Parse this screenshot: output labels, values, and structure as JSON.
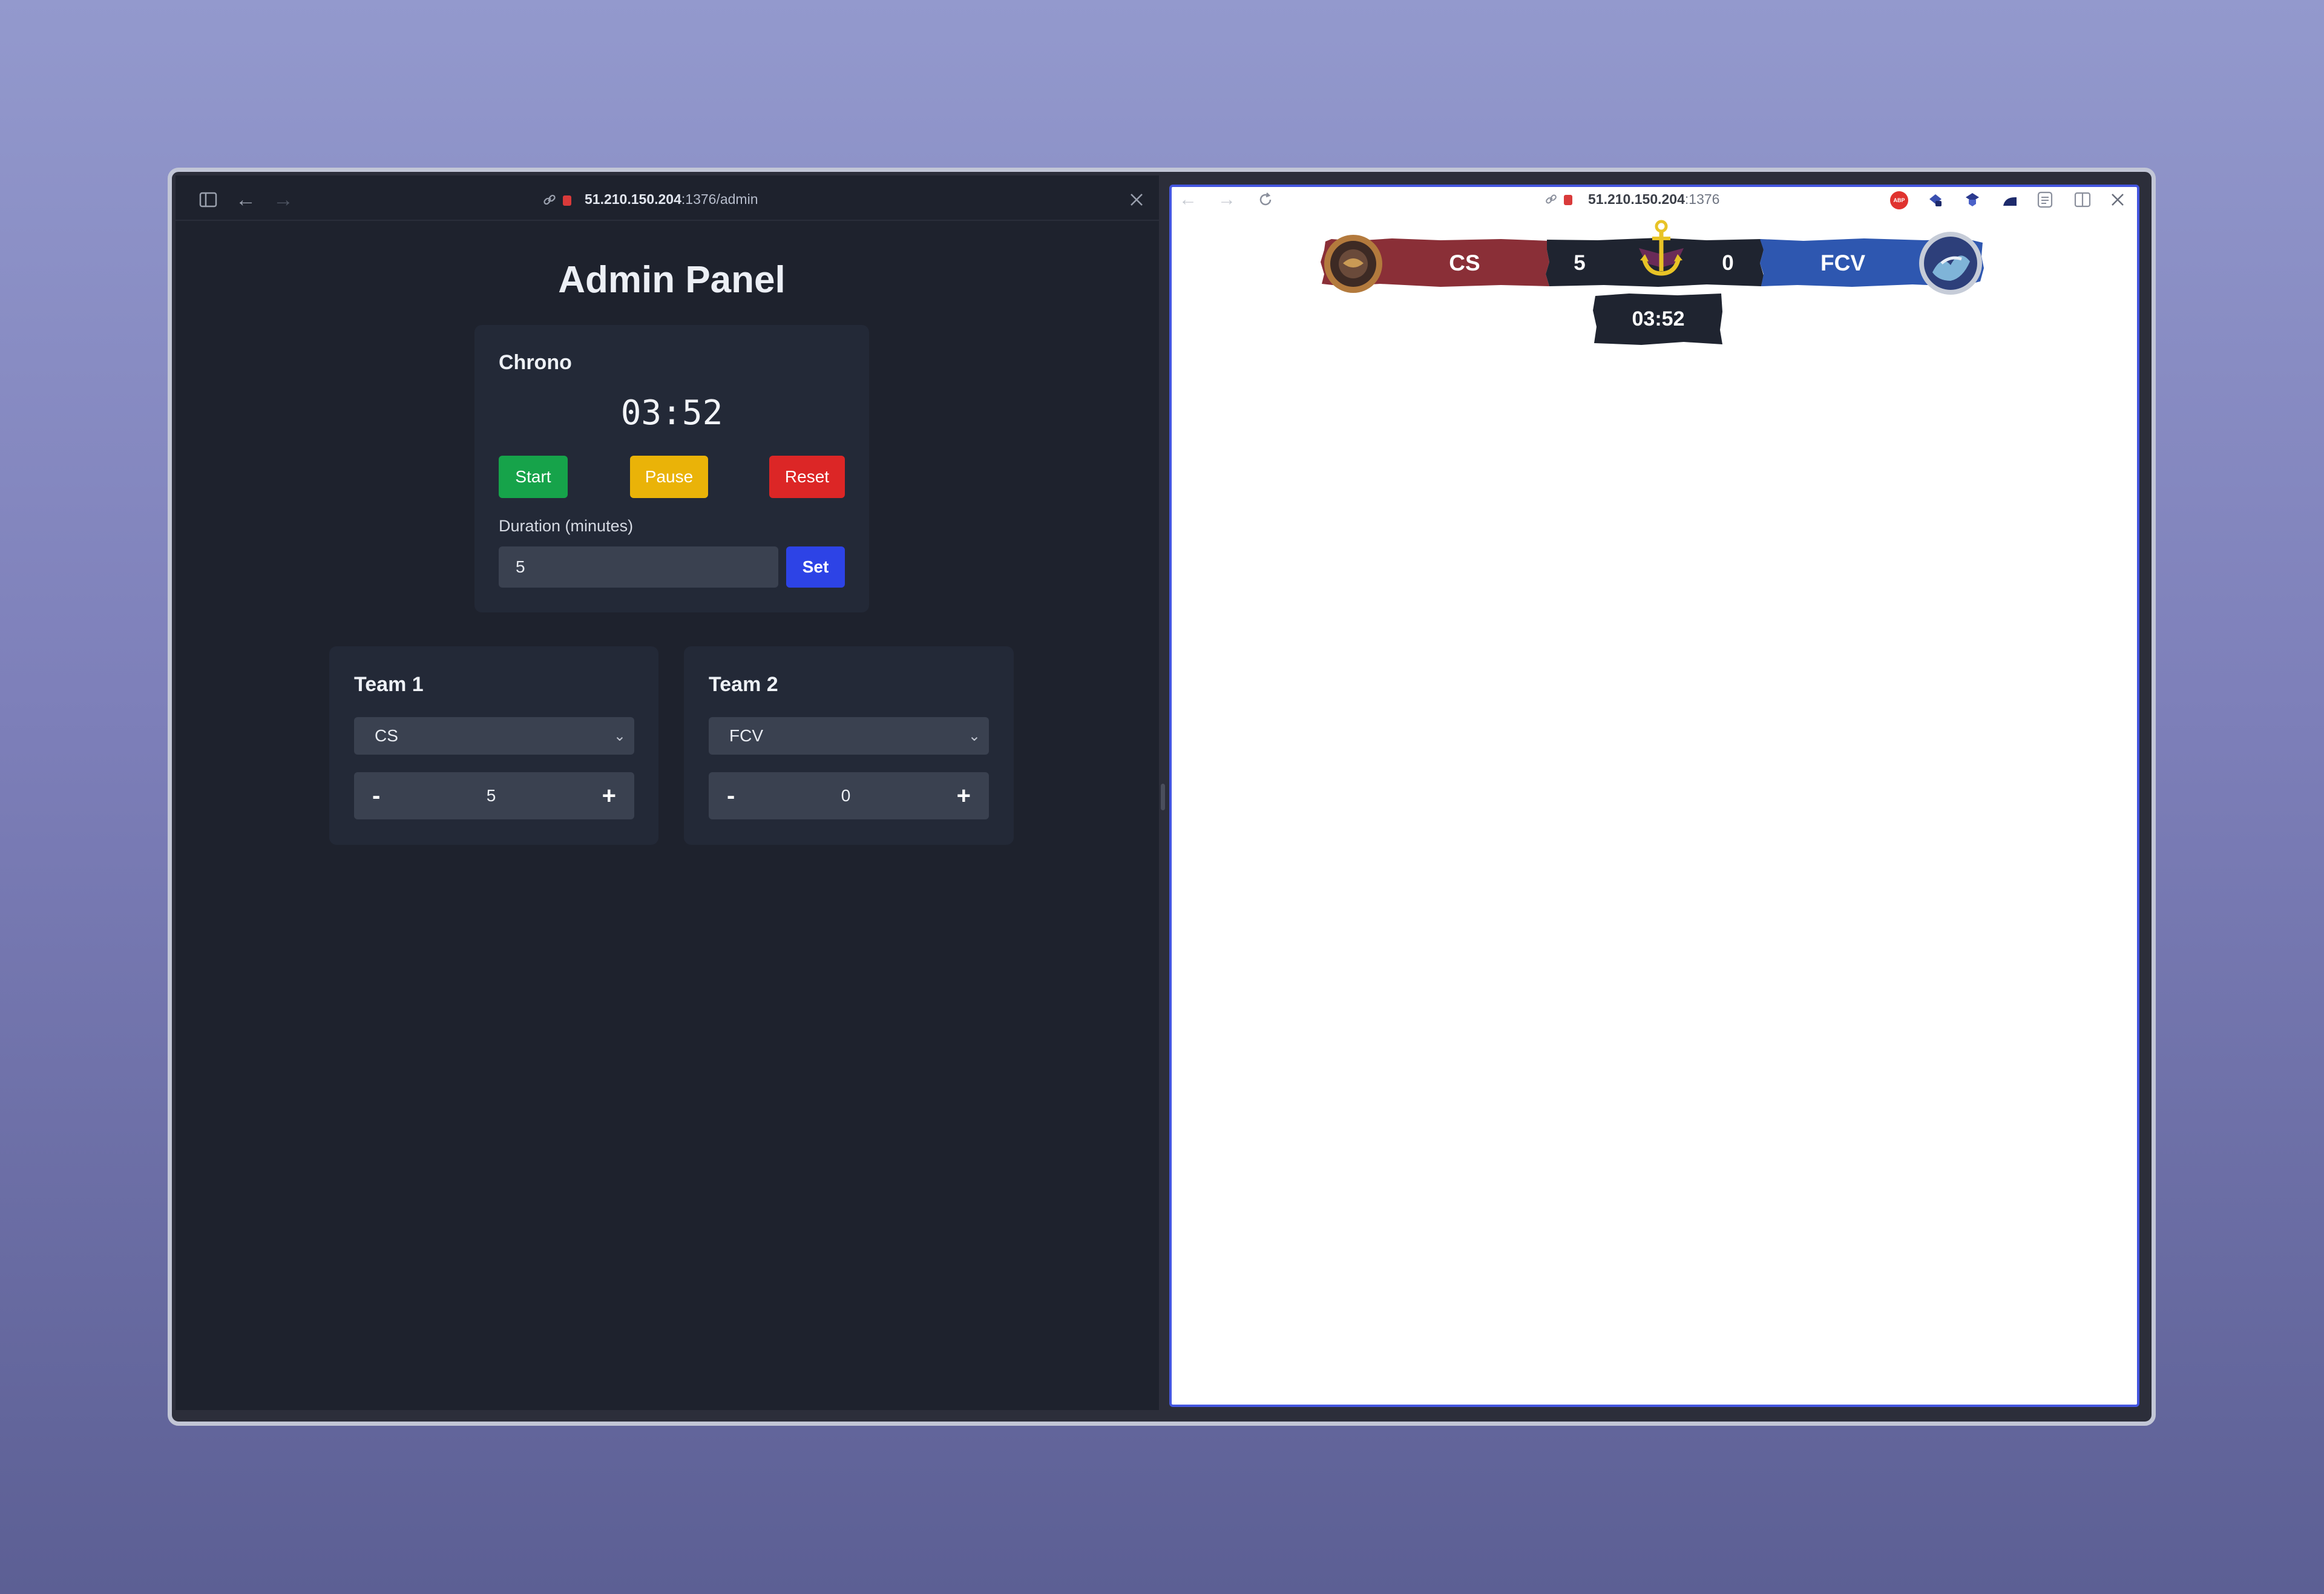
{
  "left_browser": {
    "url_host": "51.210.150.204",
    "url_path": ":1376/admin",
    "icons": [
      "sidebar-icon",
      "back-icon",
      "forward-icon",
      "link-icon",
      "lock-icon",
      "close-icon"
    ]
  },
  "admin": {
    "title": "Admin Panel",
    "chrono": {
      "title": "Chrono",
      "time": "03:52",
      "start_label": "Start",
      "pause_label": "Pause",
      "reset_label": "Reset",
      "duration_label": "Duration (minutes)",
      "duration_value": "5",
      "set_label": "Set"
    },
    "team1": {
      "title": "Team 1",
      "selected": "CS",
      "score": "5",
      "minus": "-",
      "plus": "+"
    },
    "team2": {
      "title": "Team 2",
      "selected": "FCV",
      "score": "0",
      "minus": "-",
      "plus": "+"
    }
  },
  "right_browser": {
    "url_host": "51.210.150.204",
    "url_path": ":1376",
    "extension_badge": "ABP",
    "icons": [
      "back-icon",
      "forward-icon",
      "reload-icon",
      "link-icon",
      "lock-icon",
      "adblock-icon",
      "extension-icon",
      "extension-shield-icon",
      "extension-arc-icon",
      "reader-icon",
      "split-view-icon",
      "close-icon"
    ]
  },
  "scoreboard": {
    "team1_name": "CS",
    "team1_score": "5",
    "team2_name": "FCV",
    "team2_score": "0",
    "time": "03:52",
    "colors": {
      "team1": "#8a2f37",
      "team2": "#2e57b0",
      "center": "#1f2430",
      "anchor": "#e8c326"
    }
  }
}
